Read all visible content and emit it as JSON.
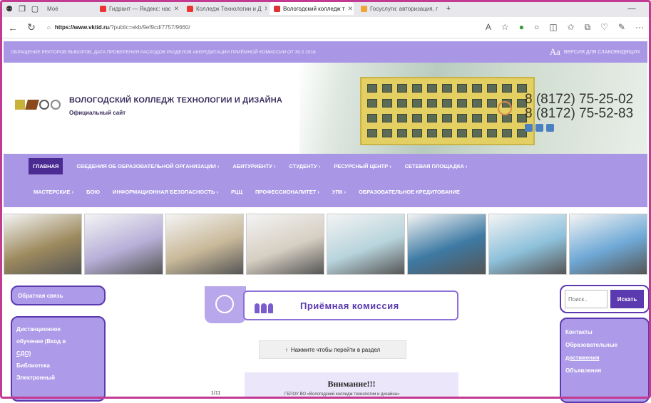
{
  "browser": {
    "tabs": [
      {
        "label": "Моё",
        "color": "#e33"
      },
      {
        "label": "Гидрант — Яндекс: нас",
        "color": "#e33"
      },
      {
        "label": "Колледж Технологии и Д",
        "color": "#e33"
      },
      {
        "label": "Вологодский колледж т",
        "color": "#d33"
      },
      {
        "label": "Госуслуги: авторизация, г",
        "color": "#f2a33a"
      }
    ],
    "url_host": "https://www.vktid.ru",
    "url_path": "/?public=ekb/9ef9cd/7757/9660/",
    "back_icon": "back-arrow-icon",
    "reload_icon": "reload-icon"
  },
  "accessibility_bar": {
    "text": "ОБРАЩЕНИЕ РЕКТОРОВ ВЫБОРОВ, ДАТА ПРОВЕРЕНИЯ РАСХОДОВ РАЗДЕЛОВ АККРЕДИТАЦИИ ПРИЁМНОЙ КОМИССИИ ОТ 30.0 2016",
    "aa": "Аа",
    "right_label": "ВЕРСИЯ ДЛЯ СЛАБОВИДЯЩИХ"
  },
  "header": {
    "title": "ВОЛОГОДСКИЙ КОЛЛЕДЖ ТЕХНОЛОГИИ И ДИЗАЙНА",
    "subtitle": "Официальный сайт",
    "phone1": "8 (8172) 75-25-02",
    "phone2": "8 (8172) 75-52-83"
  },
  "menu": {
    "row1": [
      "ГЛАВНАЯ",
      "СВЕДЕНИЯ ОБ ОБРАЗОВАТЕЛЬНОЙ ОРГАНИЗАЦИИ ›",
      "АБИТУРИЕНТУ ›",
      "СТУДЕНТУ ›",
      "РЕСУРСНЫЙ ЦЕНТР ›",
      "СЕТЕВАЯ ПЛОЩАДКА ›"
    ],
    "row2": [
      "МАСТЕРСКИЕ ›",
      "БОЮ",
      "ИНФОРМАЦИОННАЯ БЕЗОПАСНОСТЬ ›",
      "РЦЦ",
      "ПРОФЕССИОНАЛИТЕТ ›",
      "УПК ›",
      "ОБРАЗОВАТЕЛЬНОЕ КРЕДИТОВАНИЕ"
    ]
  },
  "photo_colors": [
    "#9d8a5e",
    "#b8b0d8",
    "#c9b99a",
    "#d6cfc2",
    "#b8d4dc",
    "#3e7aa4",
    "#8ec1db",
    "#6fa9d6"
  ],
  "sidebar_left": {
    "feedback": "Обратная связь",
    "items": [
      "Дистанционное",
      "обучение (Вход в",
      "СДО)",
      "Библиотека",
      "Электронный"
    ]
  },
  "search": {
    "placeholder": "Поиск..",
    "button": "Искать"
  },
  "sidebar_right": {
    "items": [
      "Контакты",
      "Образовательные",
      "достижения",
      "Объявления"
    ]
  },
  "admission": {
    "title": "Приёмная комиссия"
  },
  "go_button": {
    "icon": "↑",
    "label": "Нажмите чтобы перейти в раздел"
  },
  "notice": {
    "heading": "Внимание!!!",
    "text": "ГБПОУ ВО «Вологодский колледж технологии и дизайна»",
    "number": "1/11"
  }
}
